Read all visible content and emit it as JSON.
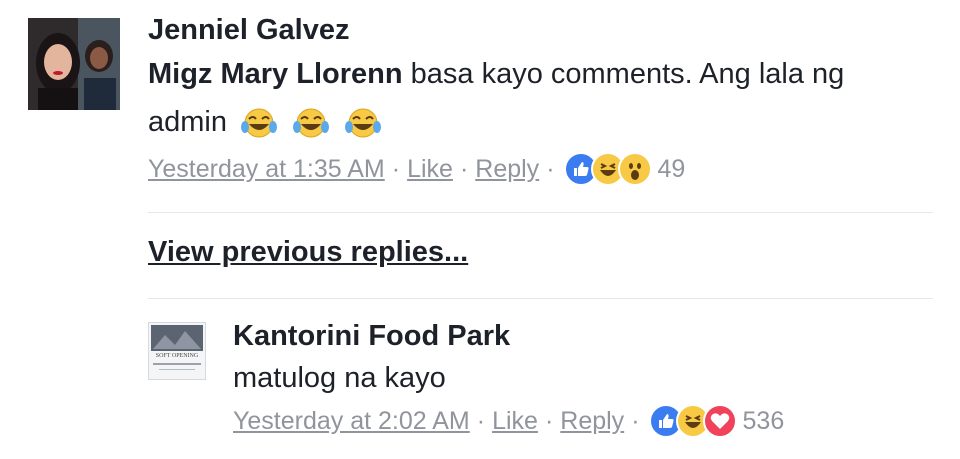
{
  "comments": [
    {
      "author": "Jenniel Galvez",
      "mention": "Migz Mary Llorenn",
      "text": "basa kayo comments. Ang lala ng admin",
      "emojis": [
        "tears-of-joy-icon",
        "tears-of-joy-icon",
        "tears-of-joy-icon"
      ],
      "timestamp": "Yesterday at 1:35 AM",
      "like_label": "Like",
      "reply_label": "Reply",
      "separator": "·",
      "reactions": [
        "like-icon",
        "haha-icon",
        "wow-icon"
      ],
      "reaction_count": "49"
    }
  ],
  "view_previous_replies": "View previous replies...",
  "replies": [
    {
      "author": "Kantorini Food Park",
      "text": "matulog na kayo",
      "avatar_caption": "SOFT OPENING",
      "timestamp": "Yesterday at 2:02 AM",
      "like_label": "Like",
      "reply_label": "Reply",
      "separator": "·",
      "reactions": [
        "like-icon",
        "haha-icon",
        "love-icon"
      ],
      "reaction_count": "536"
    }
  ],
  "colors": {
    "text": "#1d2129",
    "meta": "#90949c",
    "like_blue": "#3b7df0",
    "haha_yellow": "#f7c944",
    "love_red": "#f0425a"
  }
}
